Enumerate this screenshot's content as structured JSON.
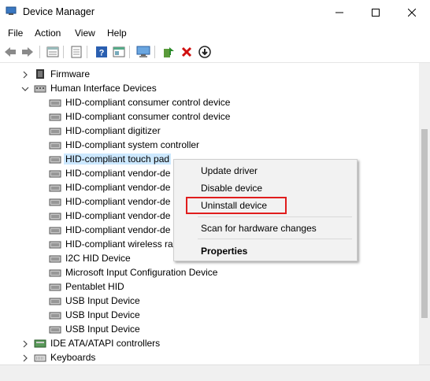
{
  "window": {
    "title": "Device Manager"
  },
  "menu": [
    "File",
    "Action",
    "View",
    "Help"
  ],
  "toolbar": {
    "icons": [
      "back-icon",
      "forward-icon",
      "properties-icon",
      "show-hide-icon",
      "help-icon",
      "view-icon",
      "scan-hardware-icon",
      "update-driver-icon",
      "uninstall-icon",
      "download-icon"
    ]
  },
  "tree": {
    "firmware": "Firmware",
    "hid": "Human Interface Devices",
    "children": [
      "HID-compliant consumer control device",
      "HID-compliant consumer control device",
      "HID-compliant digitizer",
      "HID-compliant system controller",
      "HID-compliant touch pad",
      "HID-compliant vendor-de",
      "HID-compliant vendor-de",
      "HID-compliant vendor-de",
      "HID-compliant vendor-de",
      "HID-compliant vendor-de",
      "HID-compliant wireless ra",
      "I2C HID Device",
      "Microsoft Input Configuration Device",
      "Pentablet HID",
      "USB Input Device",
      "USB Input Device",
      "USB Input Device"
    ],
    "ide": "IDE ATA/ATAPI controllers",
    "keyboards": "Keyboards"
  },
  "context_menu": {
    "update": "Update driver",
    "disable": "Disable device",
    "uninstall": "Uninstall device",
    "scan": "Scan for hardware changes",
    "properties": "Properties"
  },
  "colors": {
    "selection": "#cce8ff",
    "highlight_box": "#e01d1d"
  }
}
